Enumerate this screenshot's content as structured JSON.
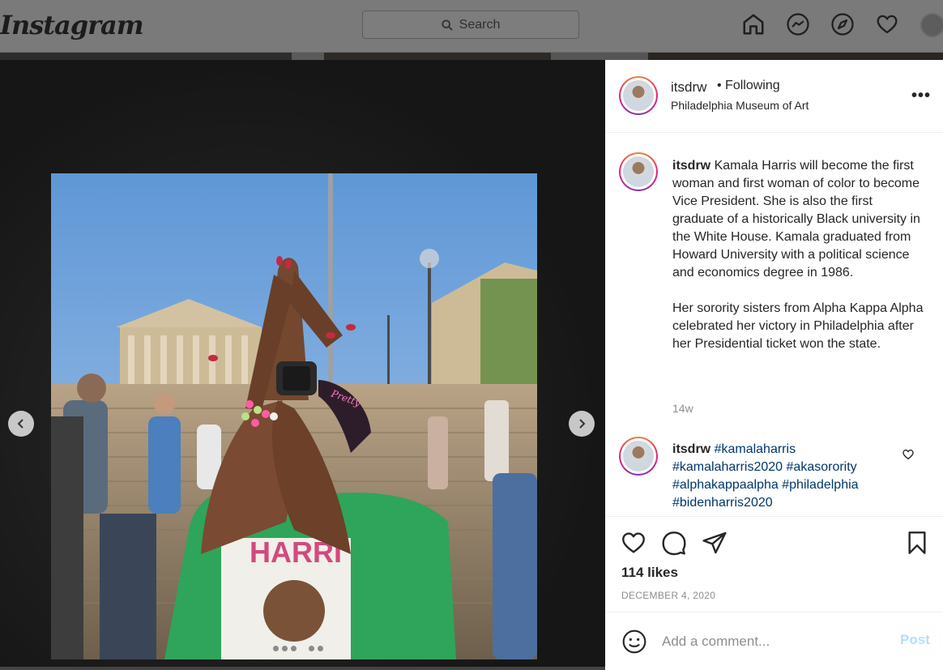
{
  "app": {
    "logo": "Instagram"
  },
  "search": {
    "placeholder": "Search"
  },
  "nav": {
    "icons": [
      "home-icon",
      "messenger-icon",
      "explore-icon",
      "heart-icon",
      "profile-avatar"
    ]
  },
  "carousel": {
    "slide_count": 6,
    "active_index": 3
  },
  "post": {
    "username": "itsdrw",
    "following": "• Following",
    "location": "Philadelphia Museum of Art",
    "more": "•••",
    "caption_user": "itsdrw",
    "caption_p1": "Kamala Harris will become the first woman and first woman of color to become Vice President. She is also the first graduate of a historically Black university in the White House. Kamala graduated from Howard University with a political science and economics degree in 1986.",
    "caption_p2": "Her sorority sisters from Alpha Kappa Alpha celebrated her victory in Philadelphia after her Presidential ticket won the state.",
    "time_ago": "14w",
    "comment_user": "itsdrw",
    "hashtags": [
      "#kamalaharris",
      "#kamalaharris2020",
      "#akasorority",
      "#alphakappaalpha",
      "#philadelphia",
      "#bidenharris2020"
    ],
    "likes": "114 likes",
    "date": "DECEMBER 4, 2020"
  },
  "comment_box": {
    "placeholder": "Add a comment...",
    "post_label": "Post"
  },
  "colors": {
    "link": "#00376b",
    "post_disabled": "#b2dffc",
    "muted": "#8e8e8e"
  }
}
